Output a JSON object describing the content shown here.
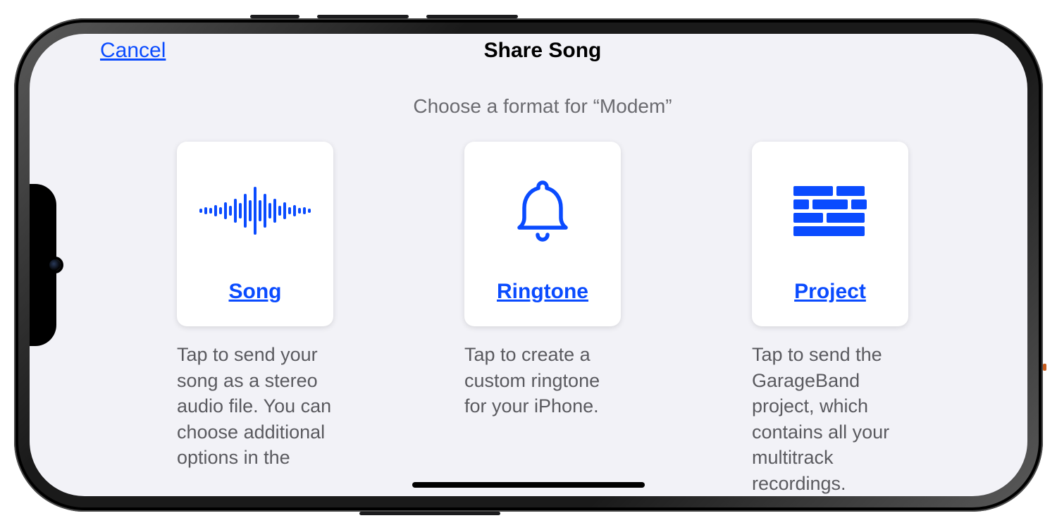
{
  "nav": {
    "cancel_label": "Cancel",
    "title": "Share Song"
  },
  "subtitle": "Choose a format for “Modem”",
  "options": {
    "song": {
      "icon": "waveform-icon",
      "label": "Song",
      "desc": "Tap to send your song as a stereo audio file. You can choose additional options in the"
    },
    "ringtone": {
      "icon": "bell-icon",
      "label": "Ringtone",
      "desc": "Tap to create a custom ringtone for your iPhone."
    },
    "project": {
      "icon": "project-bricks-icon",
      "label": "Project",
      "desc": "Tap to send the GarageBand project, which contains all your multitrack recordings."
    }
  },
  "colors": {
    "accent": "#0a4bff",
    "background": "#f2f2f7",
    "card": "#ffffff",
    "subtitle": "#6b6b70"
  }
}
